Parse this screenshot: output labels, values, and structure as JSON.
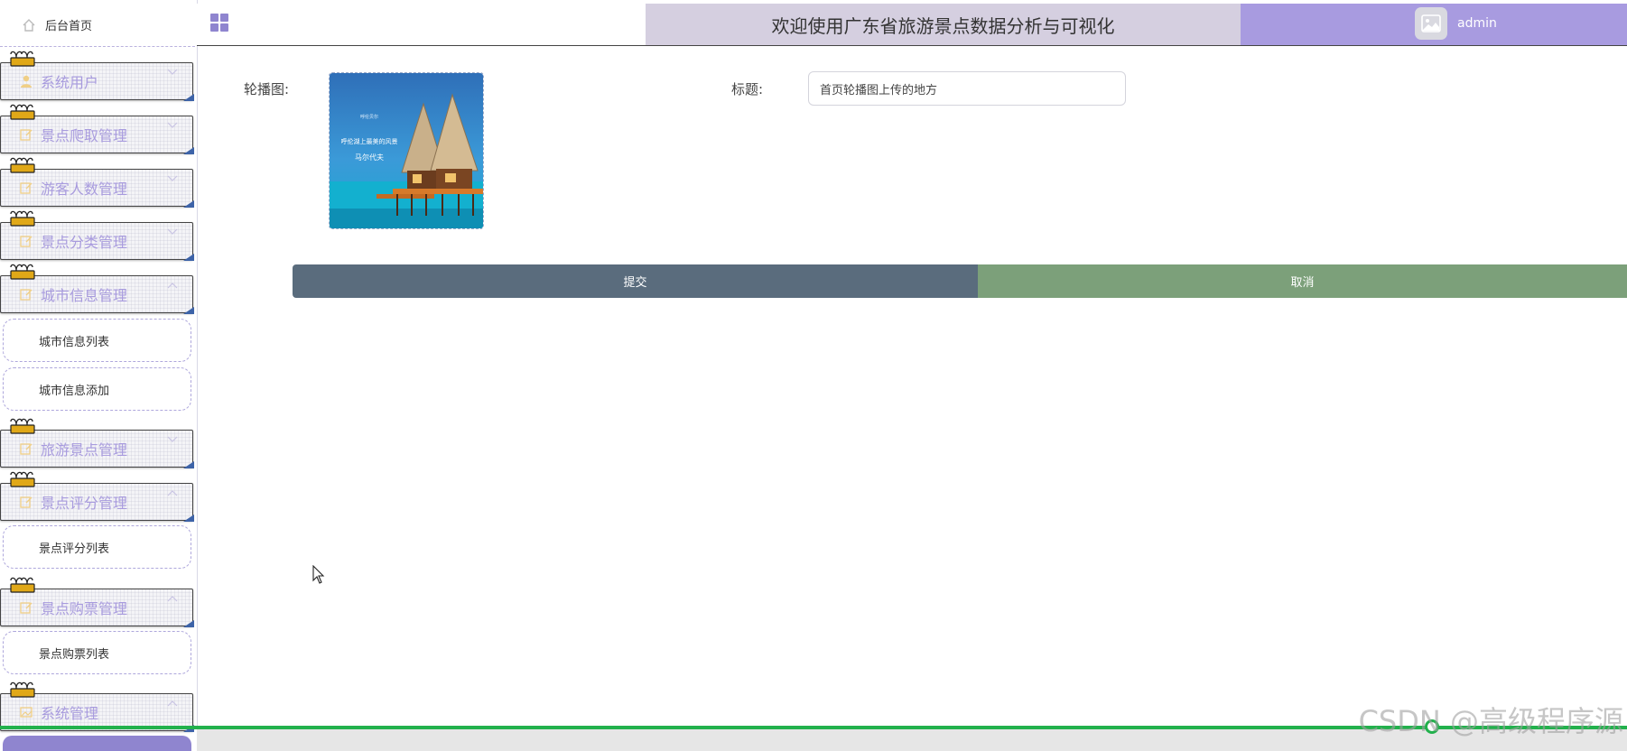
{
  "sidebar": {
    "home_label": "后台首页",
    "menu": [
      {
        "label": "系统用户",
        "icon": "user-icon"
      },
      {
        "label": "景点爬取管理",
        "icon": "edit-icon"
      },
      {
        "label": "游客人数管理",
        "icon": "edit-icon"
      },
      {
        "label": "景点分类管理",
        "icon": "edit-icon"
      },
      {
        "label": "城市信息管理",
        "icon": "edit-icon",
        "expanded": true,
        "children": [
          "城市信息列表",
          "城市信息添加"
        ]
      },
      {
        "label": "旅游景点管理",
        "icon": "edit-icon"
      },
      {
        "label": "景点评分管理",
        "icon": "edit-icon",
        "expanded": true,
        "children": [
          "景点评分列表"
        ]
      },
      {
        "label": "景点购票管理",
        "icon": "edit-icon",
        "expanded": true,
        "children": [
          "景点购票列表"
        ]
      },
      {
        "label": "系统管理",
        "icon": "image-icon"
      }
    ]
  },
  "header": {
    "title": "欢迎使用广东省旅游景点数据分析与可视化",
    "username": "admin"
  },
  "form": {
    "image_label": "轮播图:",
    "title_label": "标题:",
    "title_value": "首页轮播图上传的地方",
    "image_caption": [
      "呼伦贝尔",
      "呼伦湖上最美的风景",
      "马尔代夫"
    ],
    "submit_label": "提交",
    "cancel_label": "取消"
  },
  "watermark": "CSDN @高级程序源",
  "colors": {
    "accent": "#a89be0",
    "title_bar": "#d5cfe0",
    "submit": "#5a6c7d",
    "cancel": "#7ca07a",
    "menu_text": "#a89bde",
    "progress": "#22b14c"
  }
}
